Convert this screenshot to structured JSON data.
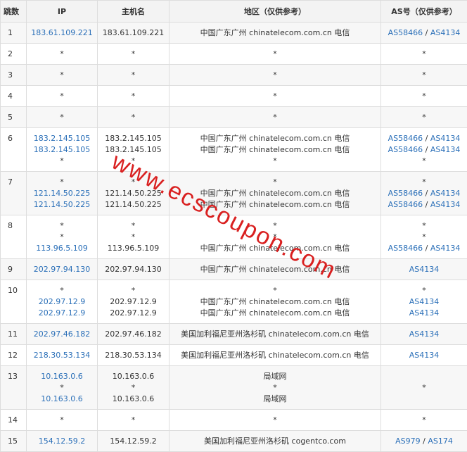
{
  "headers": {
    "hop": "跳数",
    "ip": "IP",
    "host": "主机名",
    "region": "地区（仅供参考）",
    "as": "AS号（仅供参考）"
  },
  "rows": [
    {
      "hop": "1",
      "ip": [
        "183.61.109.221"
      ],
      "host": [
        "183.61.109.221"
      ],
      "region": [
        "中国广东广州 chinatelecom.com.cn 电信"
      ],
      "as": [
        [
          "AS58466",
          "AS4134"
        ]
      ]
    },
    {
      "hop": "2",
      "ip": [
        "*"
      ],
      "host": [
        "*"
      ],
      "region": [
        "*"
      ],
      "as": [
        "*"
      ]
    },
    {
      "hop": "3",
      "ip": [
        "*"
      ],
      "host": [
        "*"
      ],
      "region": [
        "*"
      ],
      "as": [
        "*"
      ]
    },
    {
      "hop": "4",
      "ip": [
        "*"
      ],
      "host": [
        "*"
      ],
      "region": [
        "*"
      ],
      "as": [
        "*"
      ]
    },
    {
      "hop": "5",
      "ip": [
        "*"
      ],
      "host": [
        "*"
      ],
      "region": [
        "*"
      ],
      "as": [
        "*"
      ]
    },
    {
      "hop": "6",
      "ip": [
        "183.2.145.105",
        "183.2.145.105",
        "*"
      ],
      "host": [
        "183.2.145.105",
        "183.2.145.105",
        "*"
      ],
      "region": [
        "中国广东广州 chinatelecom.com.cn 电信",
        "中国广东广州 chinatelecom.com.cn 电信",
        "*"
      ],
      "as": [
        [
          "AS58466",
          "AS4134"
        ],
        [
          "AS58466",
          "AS4134"
        ],
        "*"
      ]
    },
    {
      "hop": "7",
      "ip": [
        "*",
        "121.14.50.225",
        "121.14.50.225"
      ],
      "host": [
        "*",
        "121.14.50.225",
        "121.14.50.225"
      ],
      "region": [
        "*",
        "中国广东广州 chinatelecom.com.cn 电信",
        "中国广东广州 chinatelecom.com.cn 电信"
      ],
      "as": [
        "*",
        [
          "AS58466",
          "AS4134"
        ],
        [
          "AS58466",
          "AS4134"
        ]
      ]
    },
    {
      "hop": "8",
      "ip": [
        "*",
        "*",
        "113.96.5.109"
      ],
      "host": [
        "*",
        "*",
        "113.96.5.109"
      ],
      "region": [
        "*",
        "*",
        "中国广东广州 chinatelecom.com.cn 电信"
      ],
      "as": [
        "*",
        "*",
        [
          "AS58466",
          "AS4134"
        ]
      ]
    },
    {
      "hop": "9",
      "ip": [
        "202.97.94.130"
      ],
      "host": [
        "202.97.94.130"
      ],
      "region": [
        "中国广东广州 chinatelecom.com.cn 电信"
      ],
      "as": [
        [
          "AS4134"
        ]
      ]
    },
    {
      "hop": "10",
      "ip": [
        "*",
        "202.97.12.9",
        "202.97.12.9"
      ],
      "host": [
        "*",
        "202.97.12.9",
        "202.97.12.9"
      ],
      "region": [
        "*",
        "中国广东广州 chinatelecom.com.cn 电信",
        "中国广东广州 chinatelecom.com.cn 电信"
      ],
      "as": [
        "*",
        [
          "AS4134"
        ],
        [
          "AS4134"
        ]
      ]
    },
    {
      "hop": "11",
      "ip": [
        "202.97.46.182"
      ],
      "host": [
        "202.97.46.182"
      ],
      "region": [
        "美国加利福尼亚州洛杉矶 chinatelecom.com.cn 电信"
      ],
      "as": [
        [
          "AS4134"
        ]
      ]
    },
    {
      "hop": "12",
      "ip": [
        "218.30.53.134"
      ],
      "host": [
        "218.30.53.134"
      ],
      "region": [
        "美国加利福尼亚州洛杉矶 chinatelecom.com.cn 电信"
      ],
      "as": [
        [
          "AS4134"
        ]
      ]
    },
    {
      "hop": "13",
      "ip": [
        "10.163.0.6",
        "*",
        "10.163.0.6"
      ],
      "host": [
        "10.163.0.6",
        "*",
        "10.163.0.6"
      ],
      "region": [
        "局域网",
        "*",
        "局域网"
      ],
      "as": [
        "*"
      ]
    },
    {
      "hop": "14",
      "ip": [
        "*"
      ],
      "host": [
        "*"
      ],
      "region": [
        "*"
      ],
      "as": [
        "*"
      ]
    },
    {
      "hop": "15",
      "ip": [
        "154.12.59.2"
      ],
      "host": [
        "154.12.59.2"
      ],
      "region": [
        "美国加利福尼亚州洛杉矶 cogentco.com"
      ],
      "as": [
        [
          "AS979",
          "AS174"
        ]
      ]
    }
  ],
  "watermark": "www.ecscoupon.com",
  "colors": {
    "link": "#2a6fb8",
    "watermark": "#d92020",
    "header_bg": "#f3f3f3",
    "alt_row_bg": "#f7f7f7",
    "border": "#dddddd"
  }
}
